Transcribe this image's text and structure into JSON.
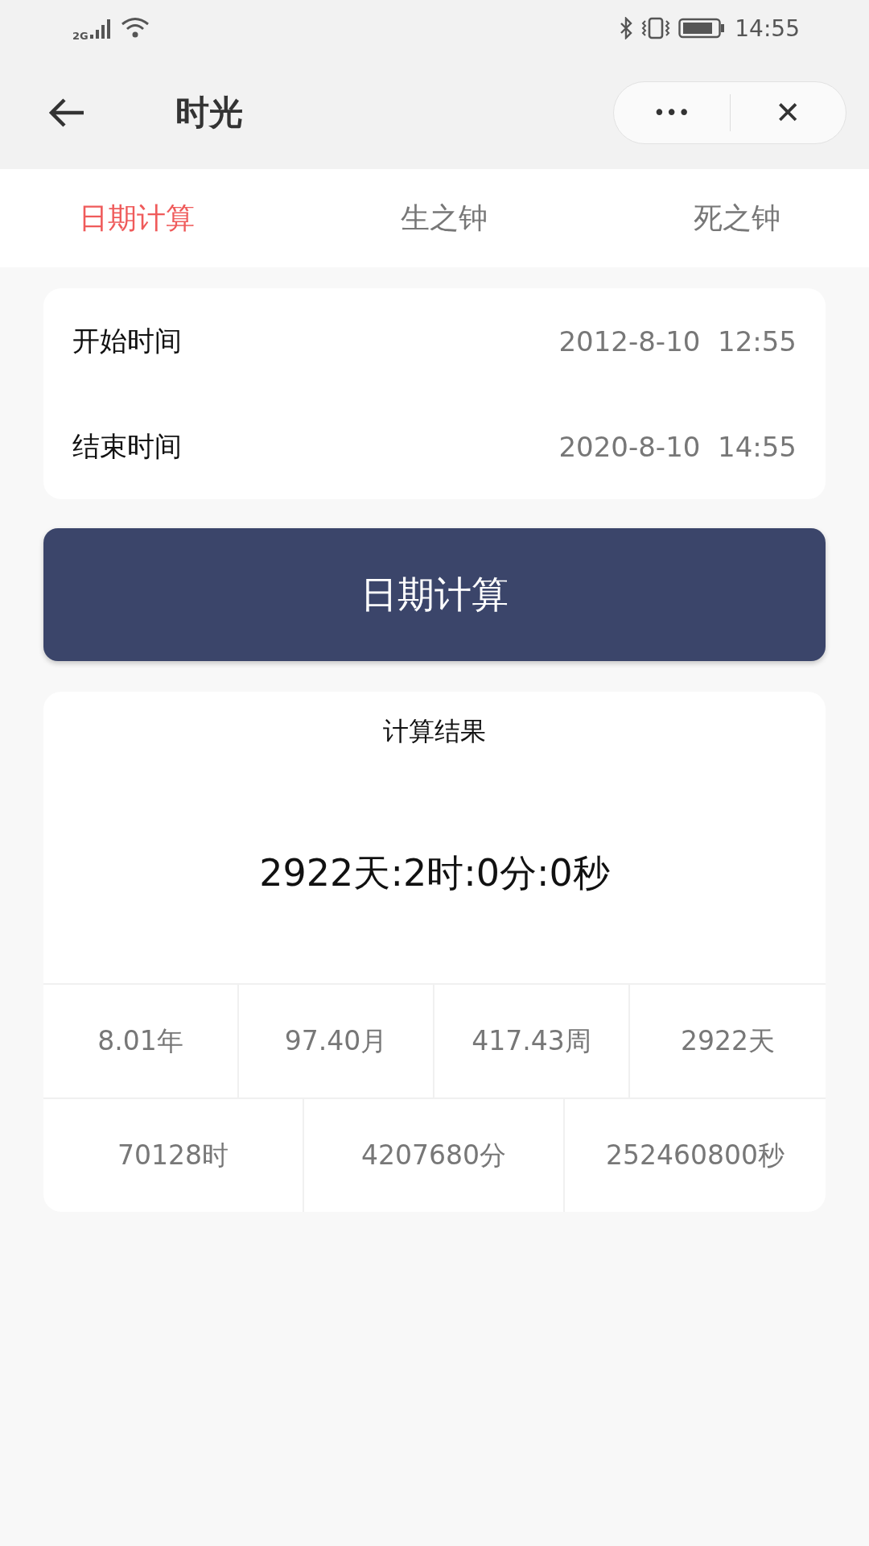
{
  "status_bar": {
    "network": "2G",
    "time": "14:55"
  },
  "nav_bar": {
    "title": "时光",
    "more": "•••",
    "close": "✕"
  },
  "tabs": [
    {
      "label": "日期计算",
      "selected": true
    },
    {
      "label": "生之钟",
      "selected": false
    },
    {
      "label": "死之钟",
      "selected": false
    }
  ],
  "time_fields": [
    {
      "label": "开始时间",
      "value": "2012-8-10  12:55"
    },
    {
      "label": "结束时间",
      "value": "2020-8-10  14:55"
    }
  ],
  "calculate_button": "日期计算",
  "result": {
    "title": "计算结果",
    "summary": "2922天:2时:0分:0秒",
    "row_1": [
      "8.01年",
      "97.40月",
      "417.43周",
      "2922天"
    ],
    "row_2": [
      "70128时",
      "4207680分",
      "252460800秒"
    ]
  }
}
